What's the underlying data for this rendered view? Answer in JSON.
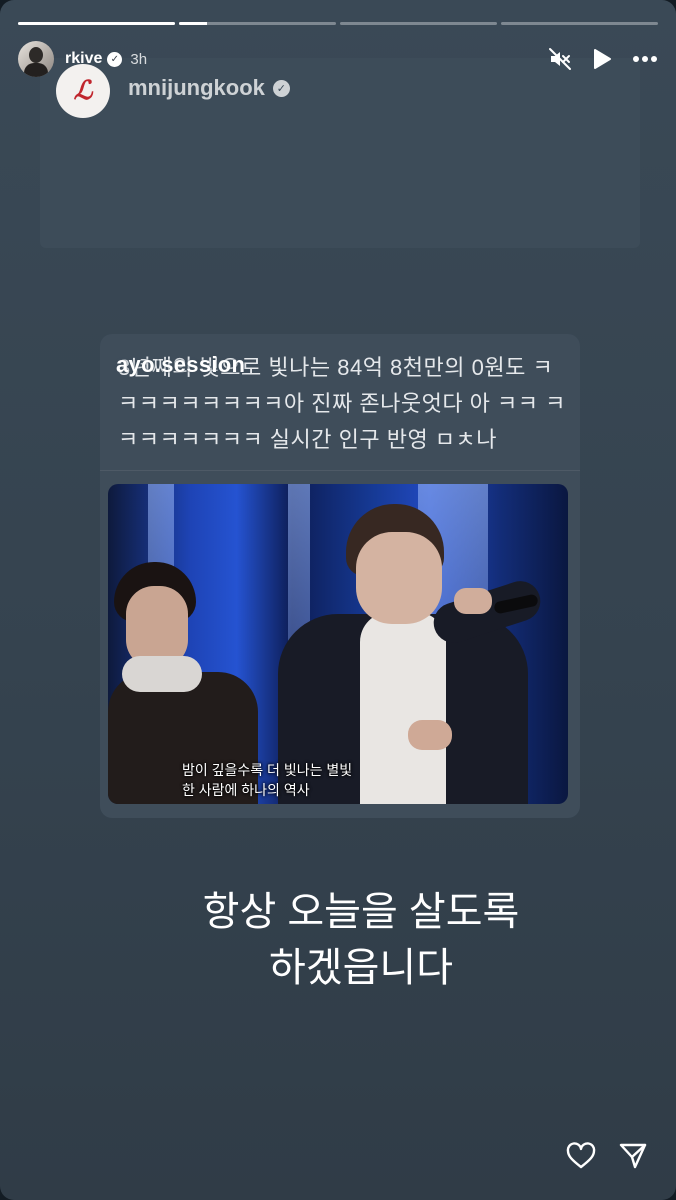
{
  "story": {
    "progress": [
      1.0,
      0.18,
      0.0,
      0.0
    ],
    "header": {
      "username": "rkive",
      "time": "3h"
    },
    "shared_post": {
      "original_username": "mnijungkook",
      "avatar_glyph": "ℒ"
    },
    "inner_post": {
      "handle": "ayo.session",
      "text": "3년째의 빛으로 빛나는 84억 8천만의 0원도 ㅋㅋㅋㅋㅋㅋㅋㅋㅋ아 진짜 존나웃엇다 아 ㅋㅋ ㅋㅋㅋㅋㅋㅋㅋㅋ 실시간 인구 반영 ㅁㅊ나",
      "video_subtitle_line1": "밤이 깊을수록 더 빛나는 별빛",
      "video_subtitle_line2": "한 사람에 하나의 역사"
    },
    "caption_line1": "항상 오늘을 살도록",
    "caption_line2": "하겠읍니다"
  },
  "icons": {
    "mute": "speaker-muted-icon",
    "play": "play-icon",
    "more": "more-icon",
    "like": "heart-icon",
    "share": "send-icon"
  },
  "colors": {
    "background": "#3a4956",
    "card": "#3d4c59",
    "text": "#ffffff"
  }
}
